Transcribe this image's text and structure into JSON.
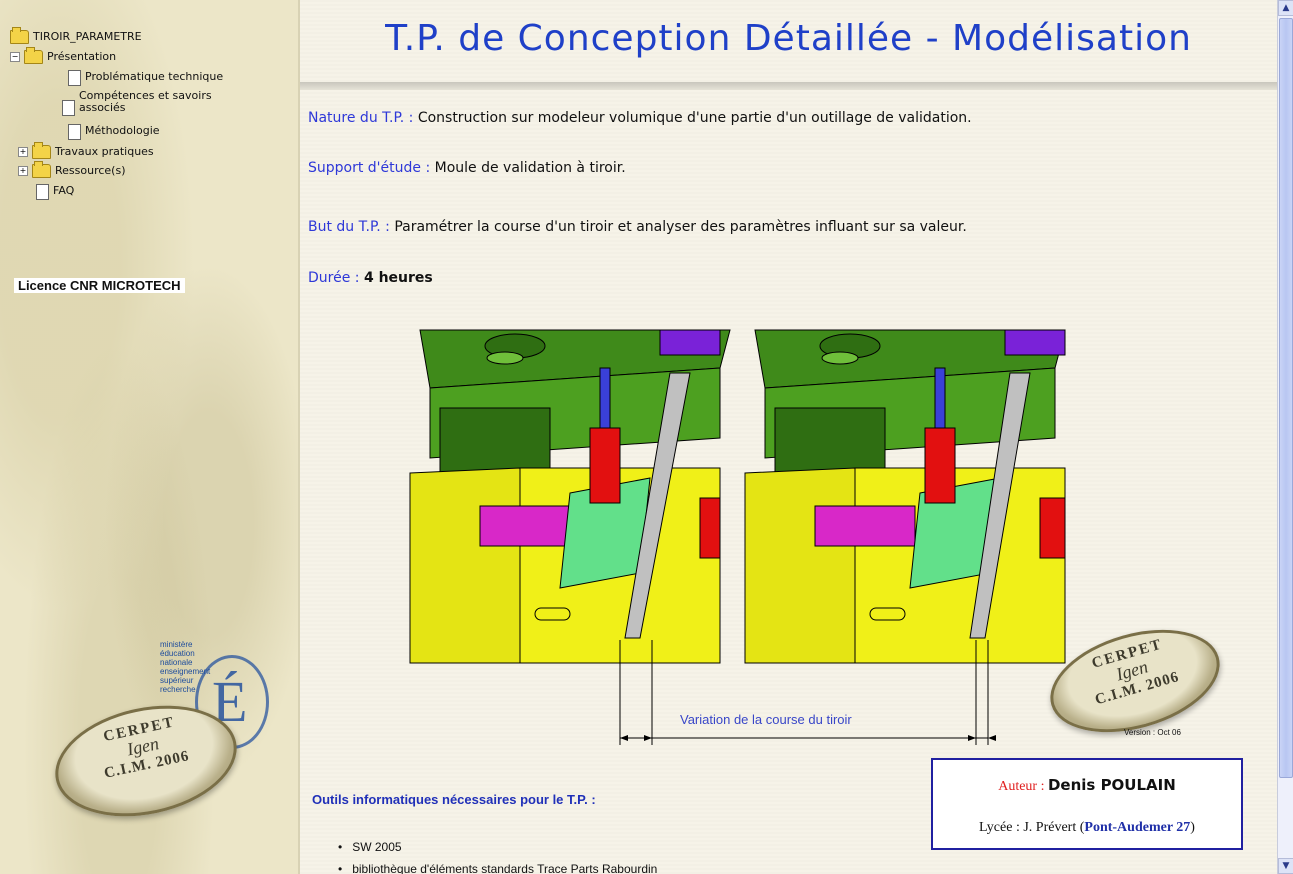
{
  "tree": {
    "root": "TIROIR_PARAMETRE",
    "items": [
      {
        "label": "Présentation"
      },
      {
        "label": "Problématique technique"
      },
      {
        "label": "Compétences et savoirs associés"
      },
      {
        "label": "Méthodologie"
      },
      {
        "label": "Travaux pratiques"
      },
      {
        "label": "Ressource(s)"
      },
      {
        "label": "FAQ"
      }
    ]
  },
  "sidebar": {
    "licence": "Licence CNR MICROTECH",
    "ministere_lines": [
      "ministère",
      "éducation",
      "nationale",
      "enseignement",
      "supérieur",
      "recherche"
    ],
    "seal": {
      "line1": "CERPET",
      "line2": "Igen",
      "line3": "C.I.M. 2006"
    }
  },
  "main": {
    "title": "T.P. de Conception Détaillée - Modélisation",
    "nature_label": "Nature du T.P. :",
    "nature_text": "Construction sur modeleur volumique d'une partie d'un  outillage de validation.",
    "support_label": "Support d'étude :",
    "support_text": "Moule de validation à tiroir.",
    "but_label": "But du T.P. :",
    "but_text": "Paramétrer la course d'un tiroir et analyser des paramètres influant sur sa valeur.",
    "duree_label": "Durée :",
    "duree_text": "4 heures",
    "figure_caption": "Variation de la course du tiroir",
    "version": "Version : Oct 06",
    "seal": {
      "line1": "CERPET",
      "line2": "Igen",
      "line3": "C.I.M. 2006"
    },
    "author": {
      "label": "Auteur :",
      "name": "Denis POULAIN",
      "school_prefix": "Lycée : J. Prévert (",
      "school_city": "Pont-Audemer 27",
      "school_suffix": ")"
    },
    "tools_heading": "Outils informatiques nécessaires pour le T.P. :",
    "tools": [
      "SW 2005",
      "bibliothèque d'éléments standards Trace Parts Rabourdin"
    ]
  },
  "colors": {
    "title_blue": "#1f40c8",
    "label_blue": "#2e38d8",
    "author_red": "#e02020"
  }
}
